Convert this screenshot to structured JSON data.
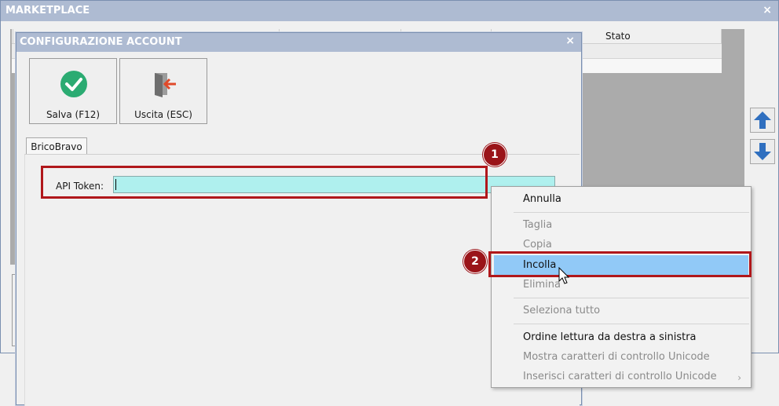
{
  "outer_window": {
    "title": "MARKETPLACE",
    "close": "×"
  },
  "grid": {
    "column_stato": "Stato"
  },
  "dialog": {
    "title": "CONFIGURAZIONE ACCOUNT",
    "close": "×",
    "toolbar": {
      "save_label": "Salva (F12)",
      "exit_label": "Uscita (ESC)"
    },
    "tab": "BricoBravo",
    "api_token_label": "API Token:",
    "api_token_value": ""
  },
  "badges": {
    "one": "1",
    "two": "2"
  },
  "context_menu": {
    "items": [
      {
        "label": "Annulla",
        "enabled": true
      },
      {
        "label": "Taglia",
        "enabled": false
      },
      {
        "label": "Copia",
        "enabled": false
      },
      {
        "label": "Incolla",
        "enabled": true,
        "highlighted": true
      },
      {
        "label": "Elimina",
        "enabled": false
      },
      {
        "label": "Seleziona tutto",
        "enabled": false
      },
      {
        "label": "Ordine lettura da destra a sinistra",
        "enabled": true
      },
      {
        "label": "Mostra caratteri di controllo Unicode",
        "enabled": false
      },
      {
        "label": "Inserisci caratteri di controllo Unicode",
        "enabled": false
      }
    ]
  },
  "colors": {
    "highlight": "#b0171b",
    "menu_hover": "#91c9f7",
    "input_bg": "#aff0ee",
    "title_bar": "#aebbd2"
  }
}
